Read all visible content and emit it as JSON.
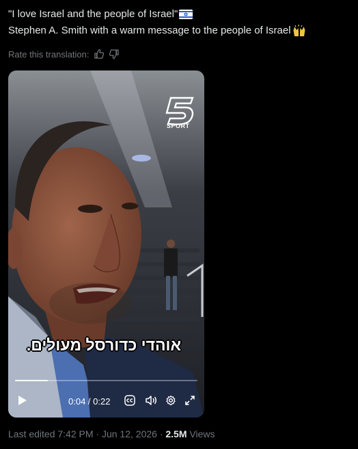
{
  "tweet": {
    "line1": "\"I love Israel and the people of Israel\"",
    "line2": "Stephen A. Smith with a warm message to the people of Israel",
    "flag_icon": "israel-flag-icon",
    "hands_icon": "raising-hands-icon"
  },
  "translation": {
    "label": "Rate this translation:",
    "thumbs_up_icon": "thumbs-up-icon",
    "thumbs_down_icon": "thumbs-down-icon"
  },
  "video": {
    "logo_text": "SPORT",
    "caption": "אוהדי כדורסל מעולים.",
    "current_time": "0:04",
    "time_separator": " / ",
    "duration": "0:22",
    "progress": 0.18
  },
  "meta": {
    "edited": "Last edited 7:42 PM · Jun 12, 2026 · ",
    "views_count": "2.5M",
    "views_label": " Views"
  },
  "colors": {
    "accent": "#1d9bf0",
    "muted": "#71767b",
    "text": "#e7e9ea"
  }
}
